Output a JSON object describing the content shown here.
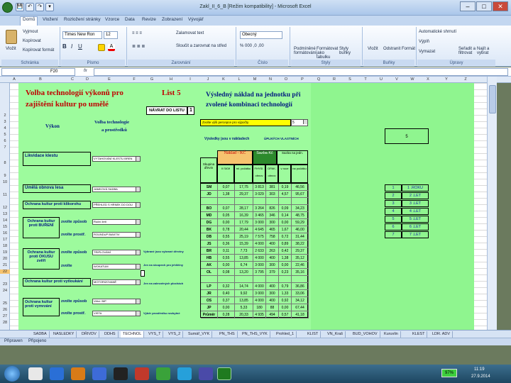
{
  "window": {
    "title": "Zakl_II_6_B [Režim kompatibility] - Microsoft Excel",
    "min": "–",
    "max": "□",
    "close": "✕"
  },
  "qat": [
    "💾",
    "↶",
    "↷",
    "▾"
  ],
  "tabs": [
    "Domů",
    "Vložení",
    "Rozložení stránky",
    "Vzorce",
    "Data",
    "Revize",
    "Zobrazení",
    "Vývojář"
  ],
  "ribbon": {
    "paste": "Vložit",
    "cut": "Vyjmout",
    "copy": "Kopírovat",
    "format_painter": "Kopírovat formát",
    "font_name": "Times New Ron",
    "font_size": "12",
    "wrap": "Zalamovat text",
    "merge": "Sloučit a zarovnat na střed",
    "number_format": "Obecný",
    "cond": "Podmíněné formátování",
    "table": "Formátovat jako tabulku",
    "styles": "Styly buňky",
    "insert": "Vložit",
    "delete": "Odstranit",
    "format": "Formát",
    "autosum": "Automatické shrnutí",
    "fill": "Výplň",
    "clear": "Vymazat",
    "sort": "Seřadit a filtrovat",
    "find": "Najít a vybrat",
    "groups": [
      "Schránka",
      "Písmo",
      "Zarovnání",
      "Číslo",
      "Styly",
      "Buňky",
      "Úpravy"
    ]
  },
  "formula_bar": {
    "cell": "F20",
    "fx": "fx",
    "value": ""
  },
  "columns": [
    "A",
    "B",
    "C",
    "D",
    "E",
    "F",
    "G",
    "H",
    "I",
    "J",
    "K",
    "L",
    "M",
    "N",
    "O",
    "P",
    "Q",
    "R",
    "S",
    "T",
    "U",
    "V",
    "W",
    "X",
    "Y",
    "Z"
  ],
  "rows": [
    "1",
    "2",
    "3",
    "4",
    "5",
    "6",
    "7",
    "8",
    "9",
    "10",
    "11",
    "12",
    "13",
    "14",
    "15",
    "16",
    "17",
    "18",
    "19",
    "20",
    "21",
    "22",
    "23",
    "24",
    "25",
    "26",
    "27",
    "28",
    "29",
    "30",
    "31",
    "32",
    "33",
    "34",
    "35",
    "36",
    "37",
    "38"
  ],
  "sheet": {
    "title_line1": "Volba technologií výkonů pro",
    "title_line2": "zajištění kultur po umělé",
    "list_label": "List 5",
    "back_button": "NÁVRAT DO LISTU",
    "back_num": "1",
    "result_title_1": "Výsledný náklad na jednotku při",
    "result_title_2": "zvolené kombinaci technologií",
    "hdr_vykon": "Výkon",
    "hdr_volba_1": "Volba technologie",
    "hdr_volba_2": "a prostředků",
    "choose_note": "Zvolte výši percepce pro výpočty",
    "choose_val": "5",
    "results_label": "Výsledky jsou v nákladech",
    "results_note": "ÚPLNÝCH VLASTNÍCH",
    "tbl_hdr_group": "Náklad - KČ",
    "tbl_hdr_cost": "Sazba Kč",
    "tbl_hdr_other": "Sazba na jedn.",
    "tbl_hdr_dreva": "Skupina dřevin",
    "tbl_hdr_sub": [
      "v roce",
      "ml. počátku",
      "FHYSI. obnov",
      "OPAK. obnov",
      "v roce",
      "na počátku"
    ],
    "left_items": [
      {
        "label": "Likvidace klestu",
        "dd": "VYTAHOVÁNÍ KLESTU BREN"
      },
      {
        "label": "Umělá obnova lesa",
        "dd": "JAMKOVÁ SADBA"
      },
      {
        "label": "Ochrana kultur proti klikorohu",
        "dd": "PŘEHLED S HRNEK DO DOU"
      },
      {
        "label": "Ochrana kultur proti BUŘENÍ",
        "sub1": "zvolte způsob",
        "dd1": "Ruční žetí",
        "sub2": "zvolte prostř.",
        "dd2": "ROUNDUP BIAKTIV"
      },
      {
        "label": "Ochrana kultur proti OKUSU zvěří",
        "sub1": "zvolte způsob",
        "dd1": "TRIPLOVÁNÍ",
        "sub2": "zvolte",
        "dd2": "WOKATUM"
      },
      {
        "label": "Ochrana kultur proti vytloukání",
        "dd": "MOTORIZOVANĚ"
      },
      {
        "label": "Ochrana kultur proti vymrzání",
        "sub1": "zvolte způsob",
        "dd1": "Větví: BIP",
        "sub2": "zvolte prostř.",
        "dd2": "VISTA"
      }
    ],
    "side_notes": [
      "Vybrané jsou vybrané dřeviny",
      "Jen na sloupech pro jehličiny",
      "Jen na zalesněných plochách",
      "Výběr prostředku nezbytné"
    ],
    "table": [
      [
        "SM",
        "0,07",
        "17,75",
        "3 813",
        "381",
        "0,19",
        "46,56"
      ],
      [
        "JD",
        "1,38",
        "29,37",
        "3 029",
        "303",
        "4,57",
        "95,67"
      ],
      [
        "",
        "",
        "",
        "",
        "",
        "",
        ""
      ],
      [
        "BO",
        "0,07",
        "28,17",
        "3 264",
        "826",
        "0,09",
        "34,23"
      ],
      [
        "MD",
        "0,05",
        "16,39",
        "3 465",
        "346",
        "0,14",
        "48,75"
      ],
      [
        "DG",
        "0,00",
        "17,79",
        "3 000",
        "300",
        "0,00",
        "59,29"
      ],
      [
        "BK",
        "0,78",
        "20,44",
        "4 645",
        "465",
        "1,67",
        "46,00"
      ],
      [
        "DB",
        "0,55",
        "25,19",
        "7 575",
        "758",
        "0,72",
        "31,44"
      ],
      [
        "JS",
        "0,36",
        "15,39",
        "4 000",
        "400",
        "0,89",
        "38,22"
      ],
      [
        "BR",
        "0,11",
        "7,73",
        "2 633",
        "263",
        "0,42",
        "29,37"
      ],
      [
        "HB",
        "0,55",
        "13,85",
        "4 000",
        "400",
        "1,38",
        "35,12"
      ],
      [
        "AK",
        "0,00",
        "6,74",
        "3 000",
        "300",
        "0,00",
        "22,46"
      ],
      [
        "OL",
        "0,08",
        "13,20",
        "3 795",
        "379",
        "0,23",
        "35,16"
      ],
      [
        "",
        "",
        "",
        "",
        "",
        "",
        ""
      ],
      [
        "LP",
        "0,32",
        "14,74",
        "4 000",
        "400",
        "0,79",
        "36,86"
      ],
      [
        "JR",
        "0,40",
        "9,92",
        "3 000",
        "300",
        "1,33",
        "33,06"
      ],
      [
        "OS",
        "0,37",
        "13,85",
        "4 000",
        "400",
        "0,92",
        "34,12"
      ],
      [
        "JP",
        "0,00",
        "5,33",
        "180",
        "88",
        "0,00",
        "67,44"
      ],
      [
        "Průměr",
        "0,28",
        "20,33",
        "4 935",
        "494",
        "0,57",
        "41,18"
      ]
    ],
    "right_header": "5",
    "right_table": [
      [
        "1",
        "1 .ROKU"
      ],
      [
        "2",
        "2 .LET"
      ],
      [
        "3",
        "3 .LET"
      ],
      [
        "4",
        "4 .LET"
      ],
      [
        "5",
        "5 .LET"
      ],
      [
        "6",
        "6 .LET"
      ],
      [
        "7",
        "7 .LET"
      ]
    ]
  },
  "sheets": [
    "SADBA",
    "NASLEDKY",
    "DŘIVDV",
    "DDHS",
    "TECHNOL",
    "VYS_T",
    "VYS_2",
    "Sumář_VYK",
    "PN_THS",
    "PN_THS_VYK",
    "Prohled_1",
    "KLIST",
    "VN_Kraš",
    "BUD_VOHOV",
    "Kuruvlin",
    "KLEST",
    "LDR. ADV"
  ],
  "status": {
    "left": "Připraven",
    "right": "Připojeno"
  },
  "taskbar": {
    "time": "11:19",
    "date": "27.9.2014",
    "battery": "97%"
  }
}
